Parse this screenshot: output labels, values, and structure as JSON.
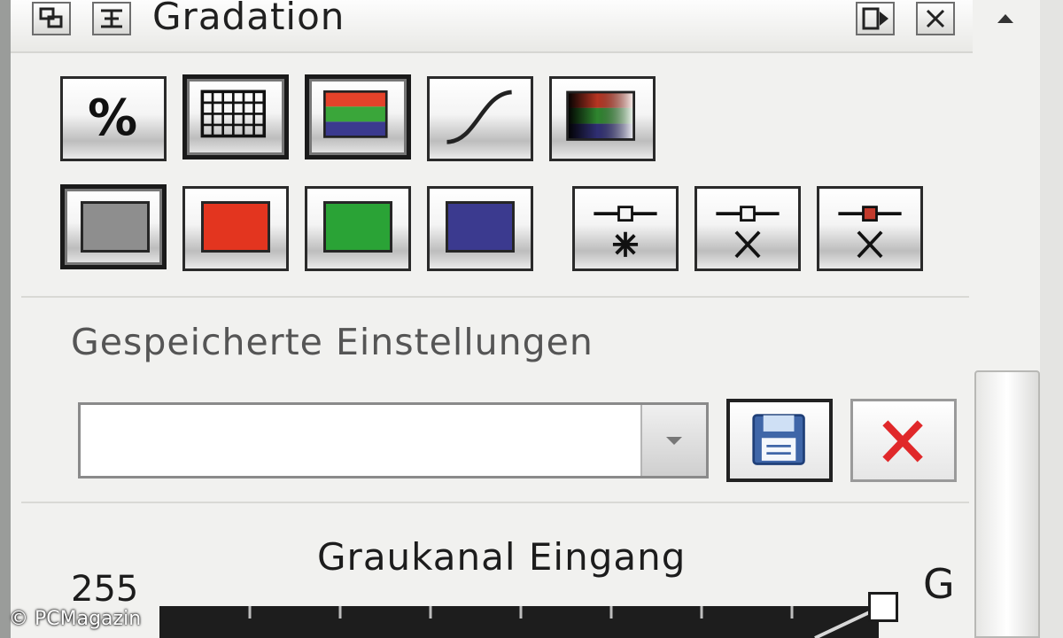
{
  "panel": {
    "title": "Gradation"
  },
  "toolbar": {
    "percent_label": "%"
  },
  "saved_settings": {
    "label": "Gespeicherte Einstellungen",
    "combo_value": ""
  },
  "curve": {
    "title": "Graukanal Eingang",
    "y_max_label": "255",
    "channel_label": "G"
  },
  "watermark": "© PCMagazin",
  "colors": {
    "gray_channel": "#8e8e8e",
    "red_channel": "#e3351f",
    "green_channel": "#2aa336",
    "blue_channel": "#3b3a8f",
    "delete_x": "#e0282a",
    "save_disk": "#3f66a8"
  },
  "icons": {
    "restore": "restore-icon",
    "dock": "dock-icon",
    "menu": "panel-menu-icon",
    "close": "panel-close-icon",
    "collapse": "collapse-up-icon"
  }
}
